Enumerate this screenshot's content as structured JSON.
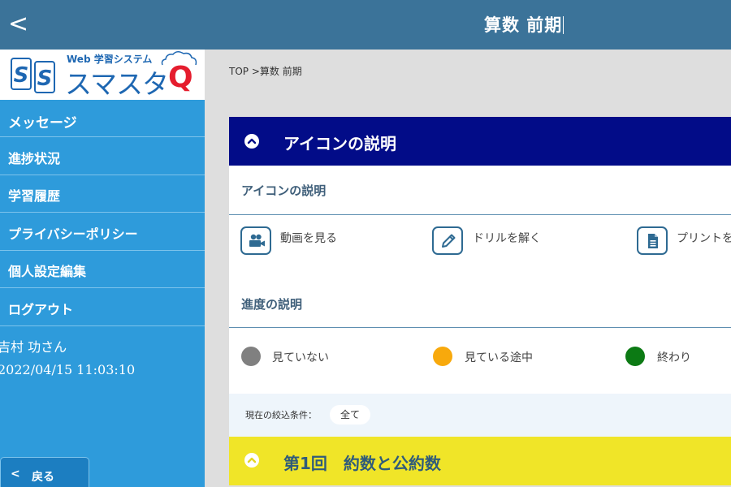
{
  "header": {
    "back_glyph": "<",
    "title": "算数 前期"
  },
  "logo": {
    "subtitle": "Web 学習システム",
    "name": "スマスタ",
    "q": "Q"
  },
  "sidebar": {
    "items": [
      {
        "label": "メッセージ"
      },
      {
        "label": "進捗状況"
      },
      {
        "label": "学習履歴"
      },
      {
        "label": "プライバシーポリシー"
      },
      {
        "label": "個人設定編集"
      },
      {
        "label": "ログアウト"
      }
    ],
    "user_name": "吉村 功さん",
    "timestamp": "2022/04/15 11:03:10",
    "back_button": {
      "chevron": "<",
      "label": "戻る"
    }
  },
  "breadcrumb": {
    "top": "TOP",
    "separator": ">",
    "current": "算数 前期"
  },
  "icon_panel": {
    "header_title": "アイコンの説明",
    "icons_heading": "アイコンの説明",
    "icons": [
      {
        "name": "video-camera-icon",
        "label": "動画を見る"
      },
      {
        "name": "pencil-icon",
        "label": "ドリルを解く"
      },
      {
        "name": "document-icon",
        "label": "プリントを"
      }
    ],
    "progress_heading": "進度の説明",
    "progress": [
      {
        "label": "見ていない",
        "color": "#808080"
      },
      {
        "label": "見ている途中",
        "color": "#f8a90c"
      },
      {
        "label": "終わり",
        "color": "#0c7a14"
      }
    ]
  },
  "filter": {
    "label": "現在の絞込条件：",
    "value": "全て"
  },
  "lesson": {
    "title": "第1回　約数と公約数"
  },
  "colors": {
    "topbar": "#3b7399",
    "sidebar": "#2e9bdb",
    "panel_header": "#020c88",
    "lesson_header": "#f0e528"
  }
}
